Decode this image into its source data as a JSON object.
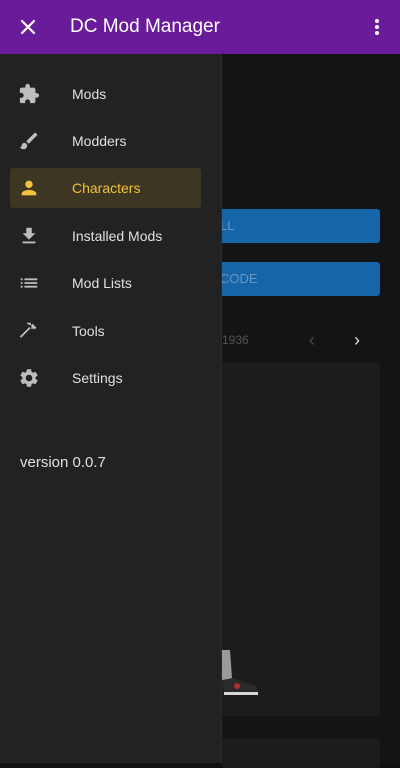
{
  "app": {
    "title": "DC Mod Manager"
  },
  "drawer": {
    "items": [
      {
        "label": "Mods",
        "icon": "puzzle-icon"
      },
      {
        "label": "Modders",
        "icon": "brush-icon"
      },
      {
        "label": "Characters",
        "icon": "person-icon",
        "active": true
      },
      {
        "label": "Installed Mods",
        "icon": "download-icon"
      },
      {
        "label": "Mod Lists",
        "icon": "list-icon"
      },
      {
        "label": "Tools",
        "icon": "hammer-icon"
      },
      {
        "label": "Settings",
        "icon": "gear-icon"
      }
    ],
    "version": "version 0.0.7"
  },
  "background": {
    "button1_label": "LL",
    "button2_label": "CODE",
    "page_text": "1936"
  },
  "colors": {
    "appbar": "#6a1b9a",
    "drawer": "#222222",
    "active_bg": "#3c3623",
    "active_text": "#f2c23a",
    "button_blue": "#1565a8"
  }
}
